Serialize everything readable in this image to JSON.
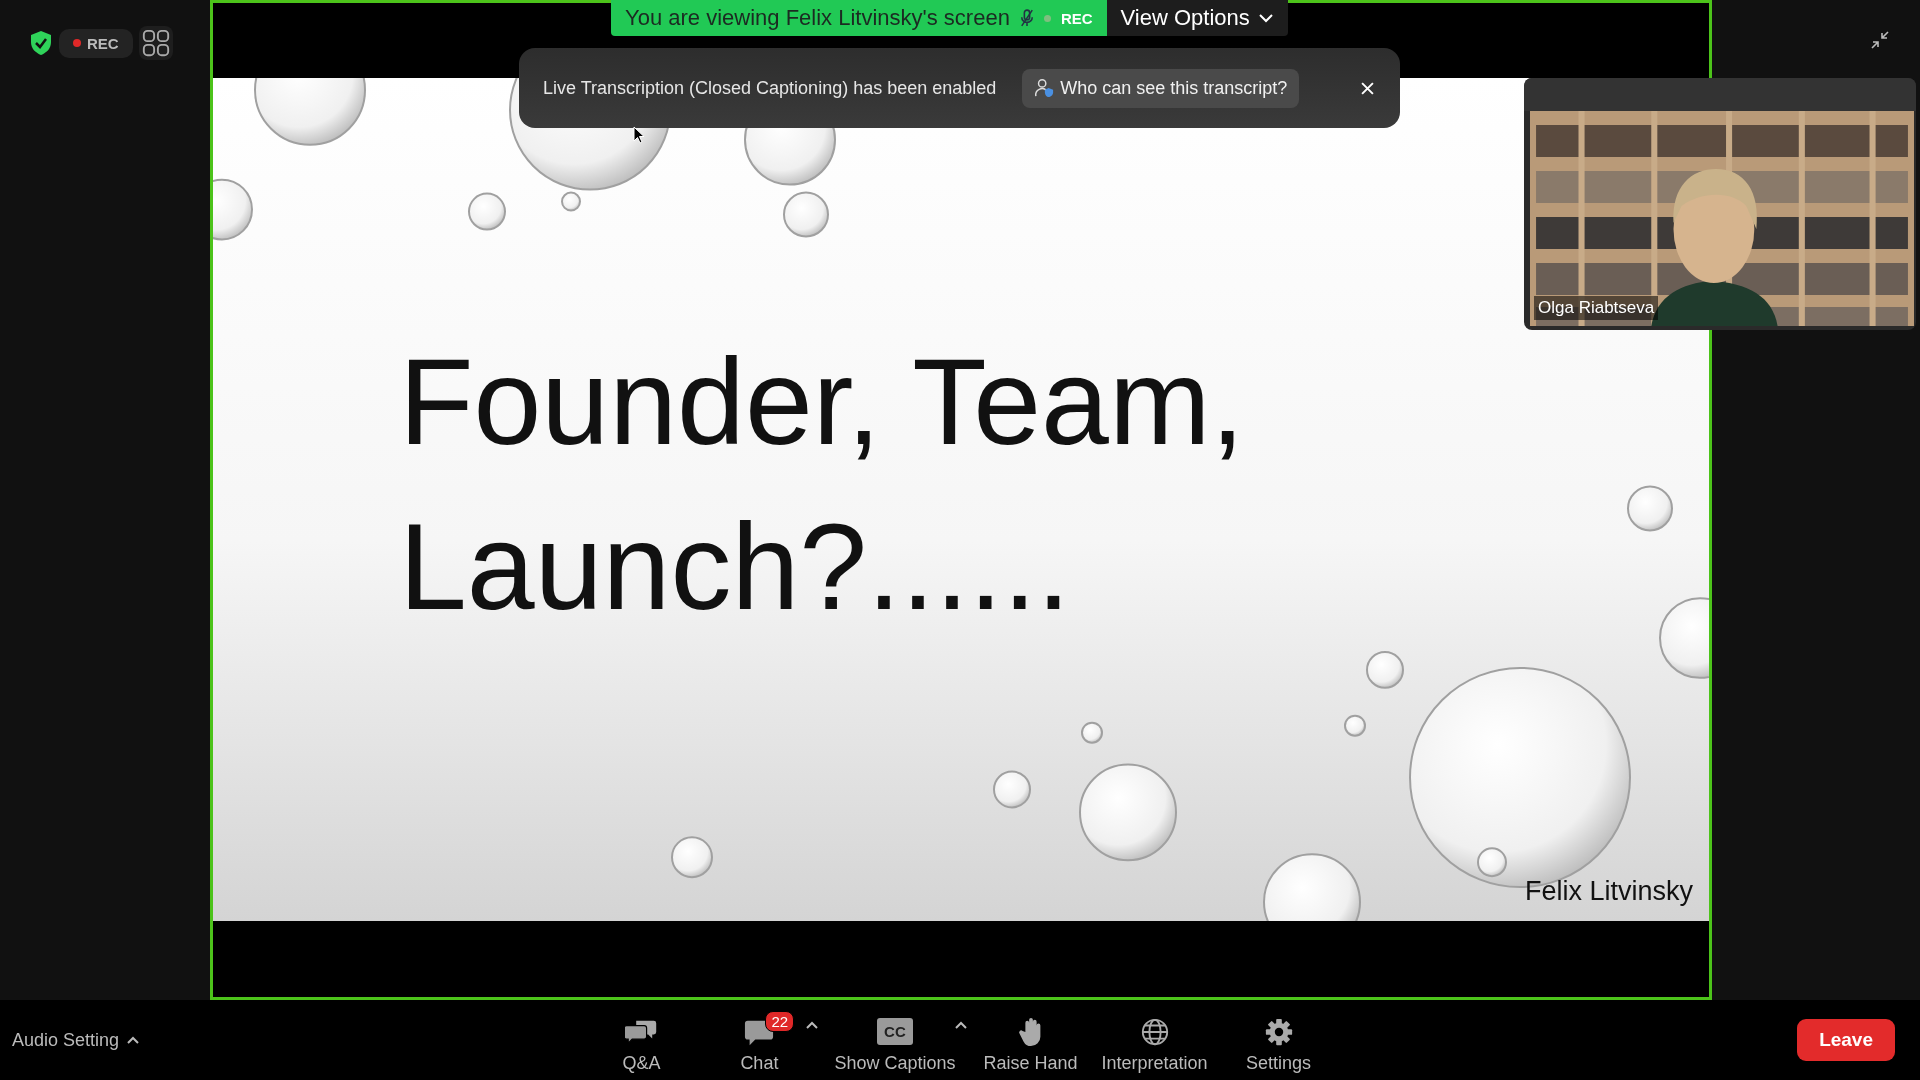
{
  "top_left": {
    "rec_label": "REC"
  },
  "share_banner": {
    "text": "You are viewing Felix Litvinsky's screen",
    "rec_label": "REC",
    "view_options": "View Options"
  },
  "notification": {
    "text": "Live Transcription (Closed Captioning) has been enabled",
    "button": "Who can see this transcript?"
  },
  "slide": {
    "title_lines": [
      "Founder, Team,",
      "Launch?......"
    ],
    "presenter": "Felix Litvinsky"
  },
  "video_tile": {
    "name": "Olga Riabtseva"
  },
  "toolbar": {
    "audio": "Audio Setting",
    "items": [
      {
        "kind": "qa",
        "label": "Q&A"
      },
      {
        "kind": "chat",
        "label": "Chat",
        "badge": "22",
        "caret": true
      },
      {
        "kind": "captions",
        "label": "Show Captions",
        "icon_text": "CC",
        "caret": true
      },
      {
        "kind": "hand",
        "label": "Raise Hand"
      },
      {
        "kind": "globe",
        "label": "Interpretation"
      },
      {
        "kind": "gear",
        "label": "Settings"
      }
    ],
    "leave": "Leave"
  }
}
